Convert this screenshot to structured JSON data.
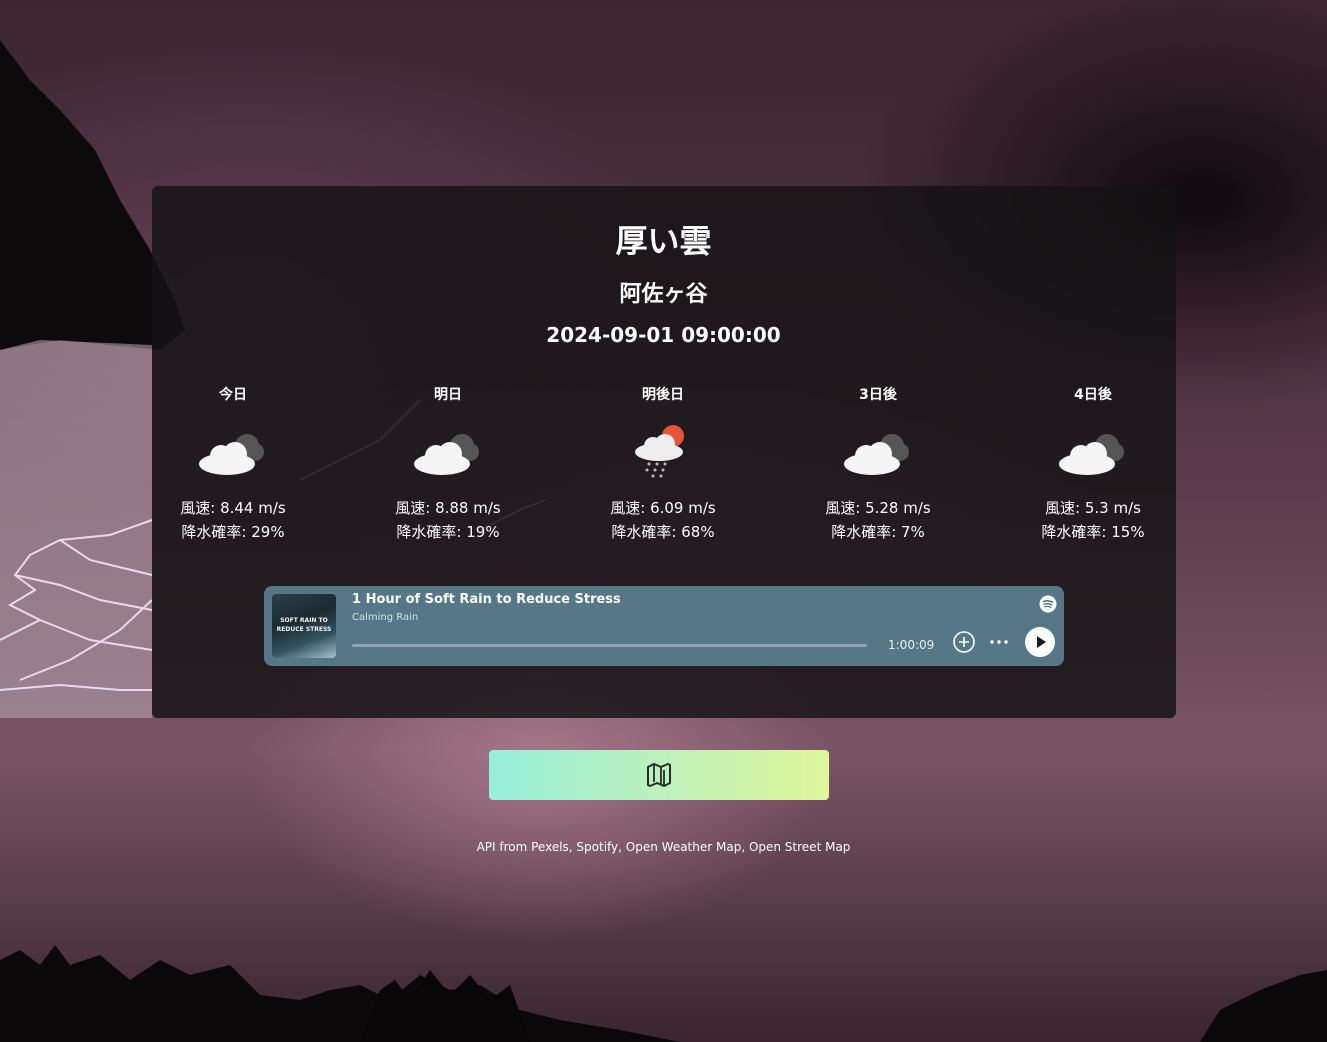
{
  "header": {
    "condition": "厚い雲",
    "location": "阿佐ヶ谷",
    "datetime": "2024-09-01 09:00:00"
  },
  "forecast": [
    {
      "day": "今日",
      "icon": "cloudy-icon",
      "wind": "風速: 8.44 m/s",
      "rain": "降水確率: 29%"
    },
    {
      "day": "明日",
      "icon": "cloudy-icon",
      "wind": "風速: 8.88 m/s",
      "rain": "降水確率: 19%"
    },
    {
      "day": "明後日",
      "icon": "sun-rain-cloud-icon",
      "wind": "風速: 6.09 m/s",
      "rain": "降水確率: 68%"
    },
    {
      "day": "3日後",
      "icon": "cloudy-icon",
      "wind": "風速: 5.28 m/s",
      "rain": "降水確率: 7%"
    },
    {
      "day": "4日後",
      "icon": "cloudy-icon",
      "wind": "風速: 5.3 m/s",
      "rain": "降水確率: 15%"
    }
  ],
  "player": {
    "track_title": "1 Hour of Soft Rain to Reduce Stress",
    "artist": "Calming Rain",
    "album_text": "SOFT RAIN TO REDUCE STRESS",
    "duration": "1:00:09",
    "progress": 0,
    "accent_color": "#557787"
  },
  "map_button": {
    "icon": "map-icon"
  },
  "footer": {
    "credits": "API from Pexels, Spotify, Open Weather Map, Open Street Map"
  }
}
